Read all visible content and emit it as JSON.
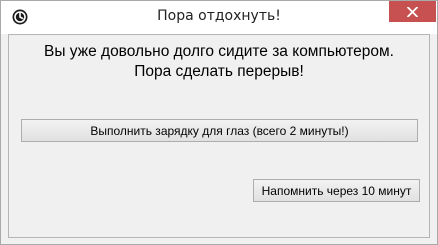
{
  "window": {
    "title": "Пора отдохнуть!",
    "app_icon": "app-icon",
    "close_icon": "close-icon",
    "accent_colors": {
      "close_button": "#c75050",
      "background": "#f0f0f0"
    }
  },
  "message": {
    "line1": "Вы уже довольно долго сидите за компьютером.",
    "line2": "Пора сделать перерыв!"
  },
  "buttons": {
    "exercise_label": "Выполнить зарядку для глаз (всего 2 минуты!)",
    "remind_label": "Напомнить через 10 минут"
  }
}
